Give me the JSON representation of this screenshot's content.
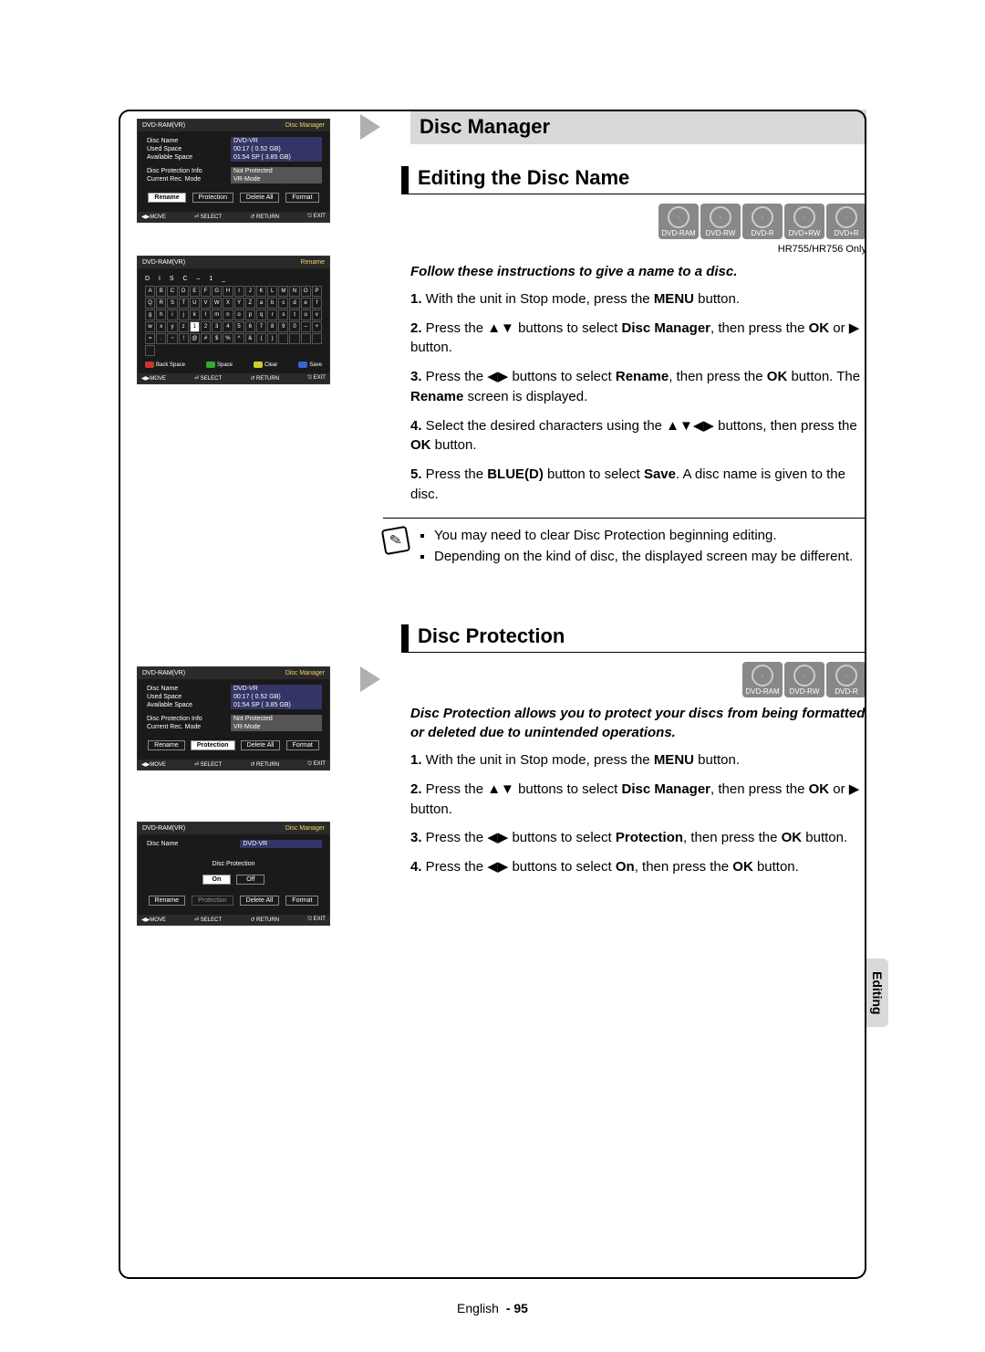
{
  "section_title": "Disc Manager",
  "edit": {
    "heading": "Editing the Disc Name",
    "badges": [
      "DVD-RAM",
      "DVD-RW",
      "DVD-R",
      "DVD+RW",
      "DVD+R"
    ],
    "model_note": "HR755/HR756 Only",
    "intro": "Follow these instructions to give a name to a disc.",
    "steps": [
      "With the unit in Stop mode, press the MENU button.",
      "Press the ▲▼ buttons to select Disc Manager, then press the OK or ▶ button.",
      "Press the ◀▶ buttons to select Rename, then press the OK button. The Rename screen is displayed.",
      "Select the desired characters using the ▲▼◀▶ buttons, then press the OK button.",
      "Press the BLUE(D) button to select Save. A disc name is given to the disc."
    ],
    "notes": [
      "You may need to clear Disc Protection beginning editing.",
      "Depending on the kind of disc, the displayed screen may be different."
    ]
  },
  "protect": {
    "heading": "Disc Protection",
    "badges": [
      "DVD-RAM",
      "DVD-RW",
      "DVD-R"
    ],
    "intro": "Disc Protection allows you to protect your discs from being formatted or deleted due to unintended operations.",
    "steps": [
      "With the unit in Stop mode, press the MENU button.",
      "Press the ▲▼ buttons to select Disc Manager, then press the OK or ▶ button.",
      "Press the ◀▶ buttons to select Protection, then press the OK button.",
      "Press the ◀▶ buttons to select On, then press the OK button."
    ]
  },
  "osd": {
    "media": "DVD-RAM(VR)",
    "screen_dm": "Disc Manager",
    "screen_rn": "Rename",
    "rows": {
      "disc_name_lbl": "Disc Name",
      "disc_name_val": "DVD-VR",
      "used_lbl": "Used Space",
      "used_val": "00:17 ( 0.52 GB)",
      "avail_lbl": "Available Space",
      "avail_val": "01:54 SP ( 3.85 GB)",
      "prot_lbl": "Disc Protection Info",
      "prot_val": "Not Protected",
      "mode_lbl": "Current Rec. Mode",
      "mode_val": "VR-Mode"
    },
    "tabs": {
      "rename": "Rename",
      "protection": "Protection",
      "delete": "Delete All",
      "format": "Format"
    },
    "foot": {
      "move": "◀▶MOVE",
      "select": "⏎ SELECT",
      "return": "↺ RETURN",
      "exit": "⎋ EXIT"
    },
    "rename_title": "D I S C – 1 _",
    "chargrid": [
      "A",
      "B",
      "C",
      "D",
      "E",
      "F",
      "G",
      "H",
      "I",
      "J",
      "K",
      "L",
      "M",
      "N",
      "O",
      "P",
      "Q",
      "R",
      "S",
      "T",
      "U",
      "V",
      "W",
      "X",
      "Y",
      "Z",
      "a",
      "b",
      "c",
      "d",
      "e",
      "f",
      "g",
      "h",
      "i",
      "j",
      "k",
      "l",
      "m",
      "n",
      "o",
      "p",
      "q",
      "r",
      "s",
      "t",
      "u",
      "v",
      "w",
      "x",
      "y",
      "z",
      "1",
      "2",
      "3",
      "4",
      "5",
      "6",
      "7",
      "8",
      "9",
      "0",
      "–",
      "+",
      "=",
      ".",
      "~",
      "!",
      "@",
      "#",
      "$",
      "%",
      "^",
      "&",
      "(",
      ")",
      "",
      "",
      "",
      "",
      ""
    ],
    "actions": {
      "back": "Back Space",
      "space": "Space",
      "clear": "Clear",
      "save": "Save"
    },
    "dp_title": "Disc Protection",
    "on": "On",
    "off": "Off"
  },
  "side_tab": "Editing",
  "footer_lang": "English",
  "footer_page": "- 95"
}
